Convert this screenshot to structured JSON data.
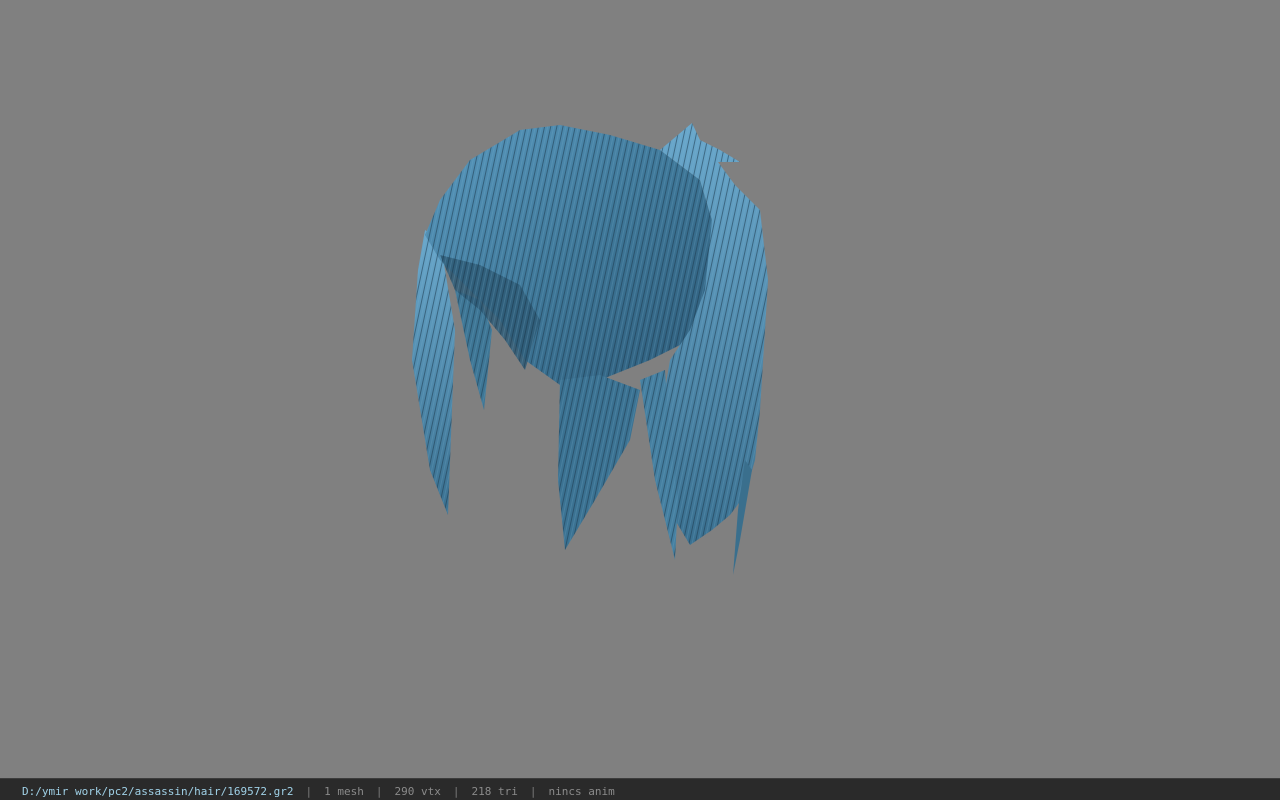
{
  "viewer": {
    "background_color": "#808080",
    "model_name": "hair-mesh",
    "model_color": "#4a86a8"
  },
  "status": {
    "file_path": "D:/ymir work/pc2/assassin/hair/169572.gr2",
    "mesh_count": "1 mesh",
    "vertex_count": "290 vtx",
    "triangle_count": "218 tri",
    "anim_status": "nincs anim",
    "separator": "|"
  }
}
